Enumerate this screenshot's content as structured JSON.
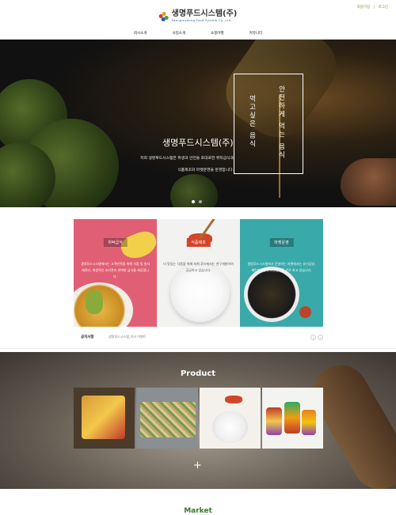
{
  "header": {
    "top_links": [
      "회원가입",
      "로그인"
    ],
    "logo_name": "생명푸드시스템(주)",
    "logo_sub": "Saengmyeong Food System Co.,Ltd",
    "nav": [
      "회사소개",
      "사업소개",
      "쇼핑마켓",
      "커뮤니티"
    ]
  },
  "hero": {
    "title": "생명푸드시스템(주)",
    "desc_line1": "저희 생명푸드시스템은 위생과 안전을 토대로한 위탁급식과",
    "desc_line2": "식품제조와 마켓운영을 운영합니다.",
    "vertical_right": "안전하게 먹는 음식",
    "vertical_left": "먹고싶은 음식",
    "slide_count": 2,
    "active_slide": 1
  },
  "business": [
    {
      "badge": "위탁급식",
      "text": "생명푸드시스템에서는 고객만족을 위해 식품 및 원자재관리, 위생적인 조리관리 완벽한 급식을 제공합니다."
    },
    {
      "badge": "식품제조",
      "text": "더 맛있는 식품을 위해 저희 푸드에서는 연구개발하여 공급하고 있습니다."
    },
    {
      "badge": "마켓운영",
      "text": "생명푸드시스템에서 운영하는 마켓에서는 유기공방, 계란판매를 온라인판매를 주로 하고 있습니다."
    }
  ],
  "notice": {
    "title": "공지사항",
    "item": "생명푸드시스템_이사 이벤트",
    "prev": "‹",
    "next": "›"
  },
  "product": {
    "title": "Product",
    "plus": "+"
  },
  "market": {
    "title": "Market"
  },
  "colors": {
    "card1": "#e15f74",
    "card2": "#f2f2f0",
    "card3": "#3aa9a9",
    "market_green": "#3a7a2e"
  }
}
